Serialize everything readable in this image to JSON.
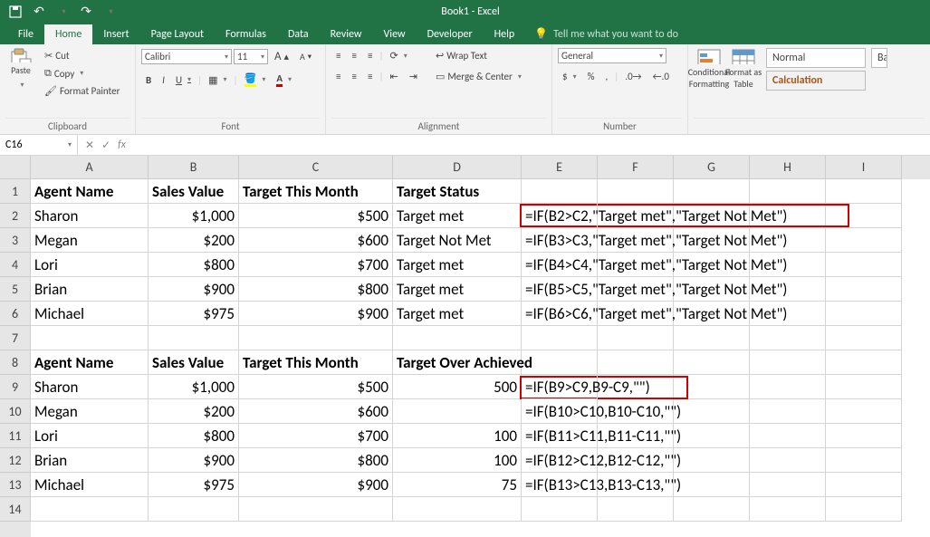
{
  "title": "Book1 - Excel",
  "qat": {
    "save": "💾",
    "undo": "↶",
    "redo": "↷"
  },
  "tabs": [
    "File",
    "Home",
    "Insert",
    "Page Layout",
    "Formulas",
    "Data",
    "Review",
    "View",
    "Developer",
    "Help"
  ],
  "tellme": "Tell me what you want to do",
  "clipboard": {
    "paste": "Paste",
    "cut": "Cut",
    "copy": "Copy",
    "painter": "Format Painter",
    "label": "Clipboard"
  },
  "font": {
    "name": "Calibri",
    "size": "11",
    "grow": "A",
    "shrink": "A",
    "bold": "B",
    "italic": "I",
    "underline": "U",
    "label": "Font"
  },
  "align": {
    "wrap": "Wrap Text",
    "merge": "Merge & Center",
    "label": "Alignment"
  },
  "number": {
    "format": "General",
    "label": "Number"
  },
  "styles": {
    "cond": "Conditional\nFormatting",
    "table": "Format as\nTable",
    "normal": "Normal",
    "calc": "Calculation",
    "bad": "Ba"
  },
  "namebox": "C16",
  "fx_label": "fx",
  "cols": {
    "A": 130,
    "B": 100,
    "C": 170,
    "D": 142,
    "E": 84,
    "F": 84,
    "G": 84,
    "H": 84,
    "I": 84
  },
  "chart_data": {
    "type": "table",
    "tables": [
      {
        "header_row": 1,
        "columns": [
          "Agent Name",
          "Sales Value",
          "Target This Month",
          "Target Status"
        ],
        "rows": [
          [
            "Sharon",
            "$1,000",
            "$500",
            "Target met"
          ],
          [
            "Megan",
            "$200",
            "$600",
            "Target Not Met"
          ],
          [
            "Lori",
            "$800",
            "$700",
            "Target met"
          ],
          [
            "Brian",
            "$900",
            "$800",
            "Target met"
          ],
          [
            "Michael",
            "$975",
            "$900",
            "Target met"
          ]
        ],
        "formulas_E": [
          "=IF(B2>C2,\"Target met\",\"Target Not Met\")",
          "=IF(B3>C3,\"Target met\",\"Target Not Met\")",
          "=IF(B4>C4,\"Target met\",\"Target Not Met\")",
          "=IF(B5>C5,\"Target met\",\"Target Not Met\")",
          "=IF(B6>C6,\"Target met\",\"Target Not Met\")"
        ]
      },
      {
        "header_row": 8,
        "columns": [
          "Agent Name",
          "Sales Value",
          "Target This Month",
          "Target Over Achieved"
        ],
        "rows": [
          [
            "Sharon",
            "$1,000",
            "$500",
            "500"
          ],
          [
            "Megan",
            "$200",
            "$600",
            ""
          ],
          [
            "Lori",
            "$800",
            "$700",
            "100"
          ],
          [
            "Brian",
            "$900",
            "$800",
            "100"
          ],
          [
            "Michael",
            "$975",
            "$900",
            "75"
          ]
        ],
        "formulas_E": [
          "=IF(B9>C9,B9-C9,\"\")",
          "=IF(B10>C10,B10-C10,\"\")",
          "=IF(B11>C11,B11-C11,\"\")",
          "=IF(B12>C12,B12-C12,\"\")",
          "=IF(B13>C13,B13-C13,\"\")"
        ]
      }
    ]
  }
}
